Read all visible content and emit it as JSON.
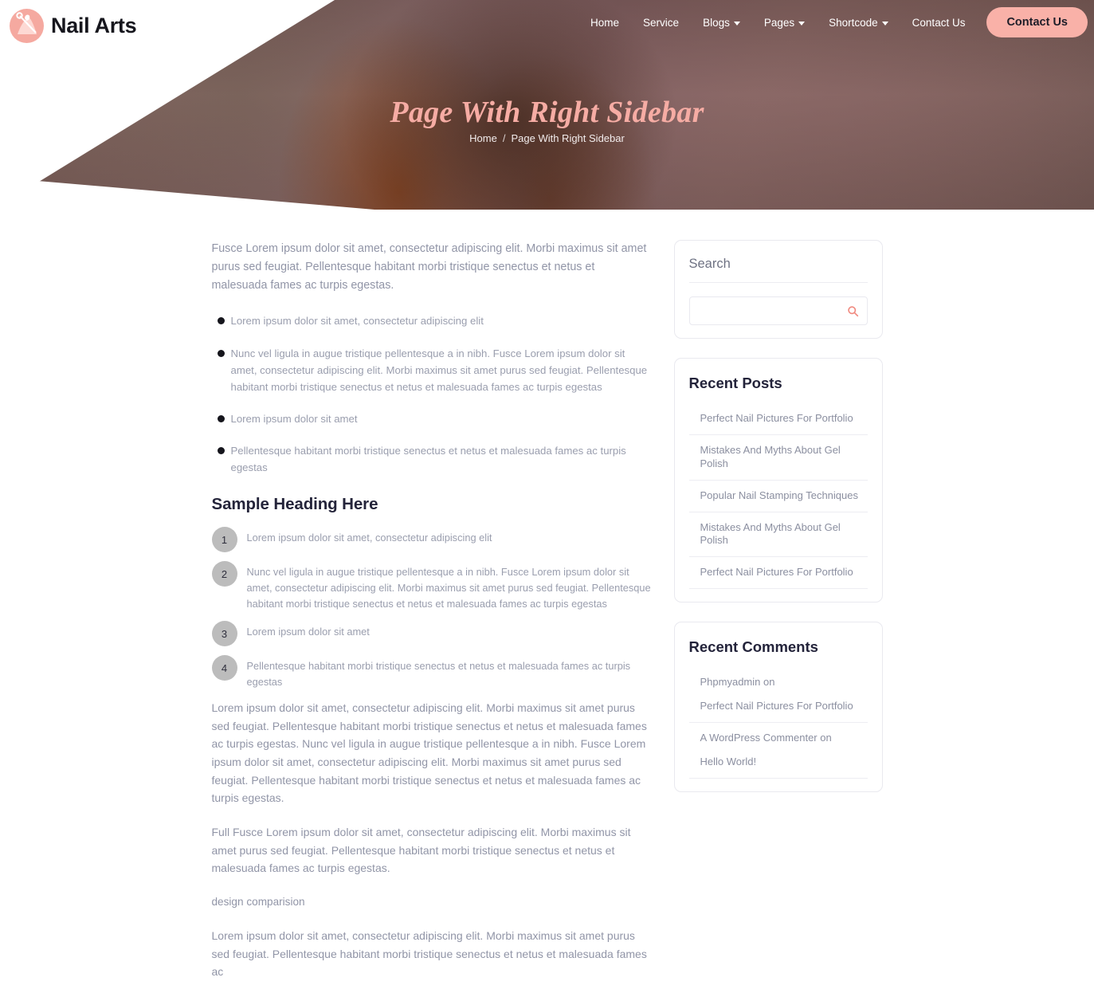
{
  "header": {
    "brand_name": "Nail Arts",
    "brand_icon": "nail-polish-brush-icon",
    "nav_items": [
      {
        "label": "Home",
        "has_dropdown": false
      },
      {
        "label": "Service",
        "has_dropdown": false
      },
      {
        "label": "Blogs",
        "has_dropdown": true
      },
      {
        "label": "Pages",
        "has_dropdown": true
      },
      {
        "label": "Shortcode",
        "has_dropdown": true
      },
      {
        "label": "Contact Us",
        "has_dropdown": false
      }
    ],
    "cta_label": "Contact Us"
  },
  "hero": {
    "title": "Page With Right Sidebar",
    "breadcrumb_home": "Home",
    "breadcrumb_separator": "/",
    "breadcrumb_current": "Page With Right Sidebar"
  },
  "content": {
    "lead": "Fusce Lorem ipsum dolor sit amet, consectetur adipiscing elit. Morbi maximus sit amet purus sed feugiat. Pellentesque habitant morbi tristique senectus et netus et malesuada fames ac turpis egestas.",
    "bullets": [
      "Lorem ipsum dolor sit amet, consectetur adipiscing elit",
      "Nunc vel ligula in augue tristique pellentesque a in nibh. Fusce Lorem ipsum dolor sit amet, consectetur adipiscing elit. Morbi maximus sit amet purus sed feugiat. Pellentesque habitant morbi tristique senectus et netus et malesuada fames ac turpis egestas",
      "Lorem ipsum dolor sit amet",
      "Pellentesque habitant morbi tristique senectus et netus et malesuada fames ac turpis egestas"
    ],
    "section_heading": "Sample Heading Here",
    "numbered_items": [
      {
        "number": "1",
        "text": "Lorem ipsum dolor sit amet, consectetur adipiscing elit"
      },
      {
        "number": "2",
        "text": "Nunc vel ligula in augue tristique pellentesque a in nibh. Fusce Lorem ipsum dolor sit amet, consectetur adipiscing elit. Morbi maximus sit amet purus sed feugiat. Pellentesque habitant morbi tristique senectus et netus et malesuada fames ac turpis egestas"
      },
      {
        "number": "3",
        "text": "Lorem ipsum dolor sit amet"
      },
      {
        "number": "4",
        "text": "Pellentesque habitant morbi tristique senectus et netus et malesuada fames ac turpis egestas"
      }
    ],
    "paragraph_1": "Lorem ipsum dolor sit amet, consectetur adipiscing elit. Morbi maximus sit amet purus sed feugiat. Pellentesque habitant morbi tristique senectus et netus et malesuada fames ac turpis egestas. Nunc vel ligula in augue tristique pellentesque a in nibh. Fusce Lorem ipsum dolor sit amet, consectetur adipiscing elit. Morbi maximus sit amet purus sed feugiat. Pellentesque habitant morbi tristique senectus et netus et malesuada fames ac turpis egestas.",
    "paragraph_2": "Full Fusce Lorem ipsum dolor sit amet, consectetur adipiscing elit. Morbi maximus sit amet purus sed feugiat. Pellentesque habitant morbi tristique senectus et netus et malesuada fames ac turpis egestas.",
    "paragraph_3": "design comparision",
    "paragraph_4": "Lorem ipsum dolor sit amet, consectetur adipiscing elit. Morbi maximus sit amet purus sed feugiat. Pellentesque habitant morbi tristique senectus et netus et malesuada fames ac"
  },
  "sidebar": {
    "search": {
      "title": "Search",
      "value": "",
      "placeholder": "",
      "icon": "search-icon"
    },
    "recent_posts": {
      "title": "Recent Posts",
      "items": [
        "Perfect Nail Pictures For Portfolio",
        "Mistakes And Myths About Gel Polish",
        "Popular Nail Stamping Techniques",
        "Mistakes And Myths About Gel Polish",
        "Perfect Nail Pictures For Portfolio"
      ]
    },
    "recent_comments": {
      "title": "Recent Comments",
      "items": [
        {
          "author": "Phpmyadmin  on",
          "post": "Perfect Nail Pictures For Portfolio"
        },
        {
          "author": "A WordPress Commenter  on",
          "post": "Hello World!"
        }
      ]
    }
  },
  "colors": {
    "accent_pink": "#f9b1a8",
    "title_pink": "#f6aca4",
    "heading_dark": "#23233a",
    "body_text": "#9195a7",
    "border": "#e9e9ef"
  }
}
